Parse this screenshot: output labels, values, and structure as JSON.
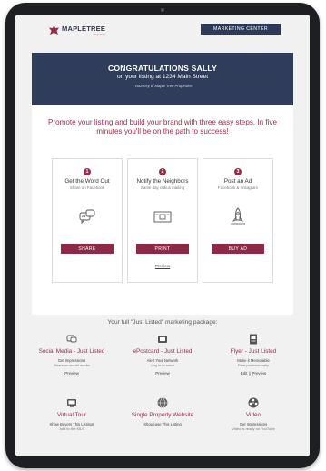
{
  "header": {
    "logo_text": "MAPLETREE",
    "logo_sub": "properties",
    "marketing_button": "MARKETING CENTER"
  },
  "hero": {
    "title": "CONGRATULATIONS SALLY",
    "subtitle": "on your listing at 1234 Main Street",
    "credit": "- courtesy of Maple Tree Properties"
  },
  "promo": {
    "text": "Promote your listing and build your brand with three easy steps. In five minutes you'll be on the path to success!"
  },
  "steps": [
    {
      "number": "1",
      "title": "Get the Word Out",
      "subtitle": "Share on Facebook",
      "button": "SHARE",
      "link": "",
      "icon": "chat-bubbles-icon"
    },
    {
      "number": "2",
      "title": "Notify the Neighbors",
      "subtitle": "Same day radius mailing",
      "button": "PRINT",
      "link": "Preview",
      "icon": "postcard-icon"
    },
    {
      "number": "3",
      "title": "Post an Ad",
      "subtitle": "Facebook & Instagram",
      "button": "BUY AD",
      "link": "",
      "icon": "rocket-icon"
    }
  ],
  "package": {
    "title": "Your full \"Just Listed\" marketing package:",
    "items": [
      {
        "title": "Social Media - Just Listed",
        "line1": "Get Impressions",
        "line2": "Share on social media",
        "link1": "Preview",
        "link2": "",
        "icon": "chat-icon"
      },
      {
        "title": "ePostcard - Just Listed",
        "line1": "Alert Your Network",
        "line2": "Log in to send",
        "link1": "Preview",
        "link2": "",
        "icon": "envelope-card-icon"
      },
      {
        "title": "Flyer - Just Listed",
        "line1": "Make it Memorable",
        "line2": "Print professionally",
        "link1": "Edit",
        "link2": "Preview",
        "icon": "flyer-icon"
      },
      {
        "title": "Virtual Tour",
        "line1": "Show Buyers This Listings",
        "line2": "Add to the MLS",
        "link1": "",
        "link2": "",
        "icon": "monitor-icon"
      },
      {
        "title": "Single Property Website",
        "line1": "Showcase This Listing",
        "line2": "",
        "link1": "",
        "link2": "",
        "icon": "globe-icon"
      },
      {
        "title": "Video",
        "line1": "Get Impressions",
        "line2": "Video is ready on YouTube",
        "link1": "",
        "link2": "",
        "icon": "film-reel-icon"
      }
    ]
  },
  "colors": {
    "brand_navy": "#2f3d5b",
    "brand_maroon": "#8e2a45",
    "tablet_frame": "#1e1f22"
  }
}
